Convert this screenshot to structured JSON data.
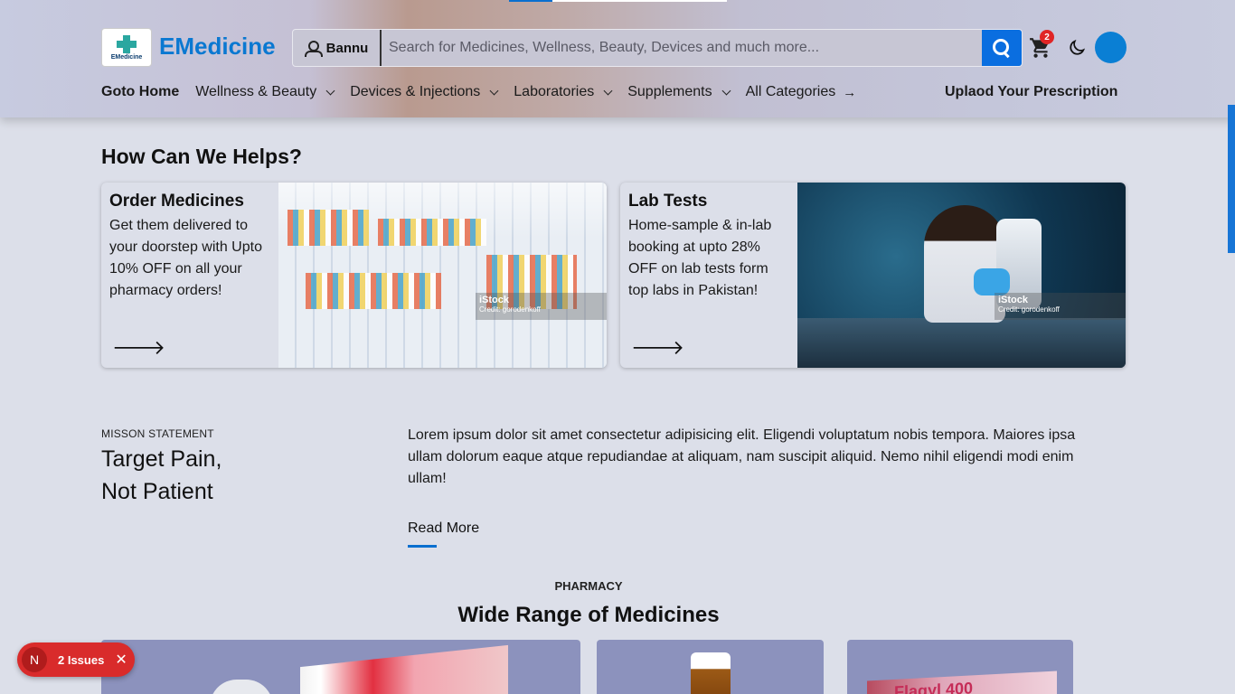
{
  "header": {
    "brand": "EMedicine",
    "logo_text": "EMedicine",
    "location": "Bannu",
    "search_placeholder": "Search for Medicines, Wellness, Beauty, Devices and much more...",
    "cart_count": "2",
    "accent": "#0a6ee0"
  },
  "nav": {
    "home": "Goto Home",
    "wellness": "Wellness & Beauty",
    "devices": "Devices & Injections",
    "labs": "Laboratories",
    "supplements": "Supplements",
    "all": "All Categories",
    "upload": "Uplaod Your Prescription"
  },
  "helps": {
    "title": "How Can We Helps?",
    "cards": [
      {
        "title": "Order Medicines",
        "text": "Get them delivered to your doorstep with Upto 10% OFF on all your pharmacy orders!",
        "image_brand": "iStock",
        "image_credit": "Credit: gorodenkoff"
      },
      {
        "title": "Lab Tests",
        "text": "Home-sample & in-lab booking at upto 28% OFF on lab tests form top labs in Pakistan!",
        "image_brand": "iStock",
        "image_credit": "Credit: gorodenkoff"
      }
    ]
  },
  "mission": {
    "label": "MISSON STATEMENT",
    "title_line1": "Target Pain,",
    "title_line2": "Not Patient",
    "text": "Lorem ipsum dolor sit amet consectetur adipisicing elit. Eligendi voluptatum nobis tempora. Maiores ipsa ullam dolorum eaque atque repudiandae at aliquam, nam suscipit aliquid. Nemo nihil eligendi modi enim ullam!",
    "read_more": "Read More"
  },
  "pharmacy": {
    "label": "PHARMACY",
    "title": "Wide Range of Medicines",
    "product3_text": "Flagyl 400"
  },
  "issues": {
    "initial": "N",
    "label": "2 Issues",
    "close": "✕"
  }
}
